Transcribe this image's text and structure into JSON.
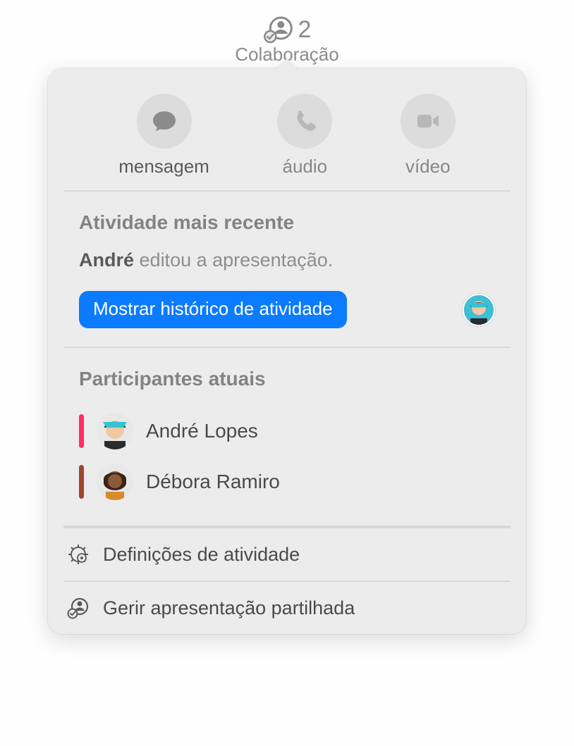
{
  "toolbar": {
    "count": "2",
    "label": "Colaboração"
  },
  "communication": {
    "message": "mensagem",
    "audio": "áudio",
    "video": "vídeo"
  },
  "activity": {
    "title": "Atividade mais recente",
    "actor": "André",
    "action": "editou a apresentação.",
    "show_history": "Mostrar histórico de atividade"
  },
  "participants": {
    "title": "Participantes atuais",
    "list": [
      {
        "name": "André Lopes",
        "color": "#ff2e63"
      },
      {
        "name": "Débora Ramiro",
        "color": "#a0462f"
      }
    ]
  },
  "menu": {
    "activity_settings": "Definições de atividade",
    "manage_shared": "Gerir apresentação partilhada"
  }
}
